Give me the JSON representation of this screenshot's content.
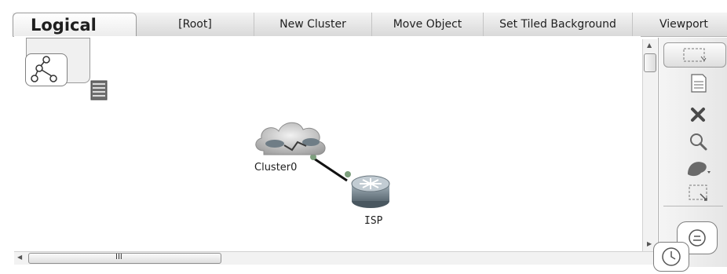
{
  "toolbar": {
    "tabs": [
      {
        "label": "Logical"
      },
      {
        "label": "[Root]"
      },
      {
        "label": "New Cluster"
      },
      {
        "label": "Move Object"
      },
      {
        "label": "Set Tiled Background"
      },
      {
        "label": "Viewport"
      }
    ]
  },
  "workspace": {
    "devices": [
      {
        "label": "Cluster0",
        "icon": "cluster-cloud-icon"
      },
      {
        "label": "ISP",
        "icon": "router-icon"
      }
    ]
  },
  "scrollbars": {
    "horizontal_grip": "III"
  },
  "tools": [
    {
      "icon": "select-icon"
    },
    {
      "icon": "note-icon"
    },
    {
      "icon": "delete-icon"
    },
    {
      "icon": "inspect-icon"
    },
    {
      "icon": "shape-icon"
    },
    {
      "icon": "resize-icon"
    }
  ],
  "modes": [
    {
      "icon": "simulation-icon"
    },
    {
      "icon": "realtime-clock-icon"
    }
  ],
  "colors": {
    "toolbar_bg": "#d9d9d9",
    "cable": "#111111",
    "link_dot": "#7d9f7d",
    "router": "#7f8f99"
  }
}
